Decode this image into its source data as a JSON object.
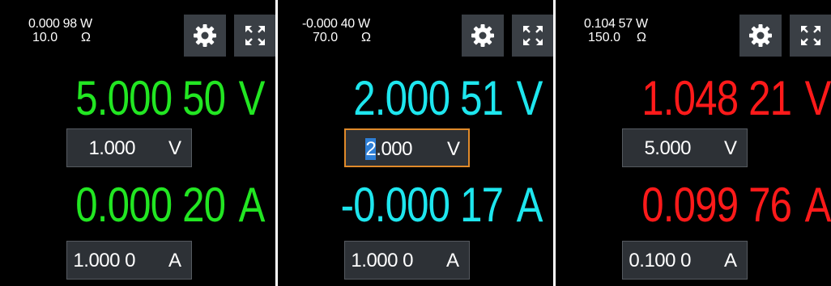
{
  "panels": [
    {
      "power": "0.000 98 W",
      "resistance": "10.0",
      "resistance_unit": "Ω",
      "voltage_measured": "5.000 50",
      "voltage_unit": "V",
      "voltage_setpoint": "1.000",
      "voltage_setpoint_unit": "V",
      "current_measured": "0.000 20",
      "current_unit": "A",
      "current_setpoint": "1.000 0",
      "current_setpoint_unit": "A",
      "color": "#22e622"
    },
    {
      "power": "-0.000 40 W",
      "resistance": "70.0",
      "resistance_unit": "Ω",
      "voltage_measured": "2.000 51",
      "voltage_unit": "V",
      "voltage_setpoint_cursor": "2",
      "voltage_setpoint_rest": ".000",
      "voltage_setpoint_unit": "V",
      "current_measured": "-0.000 17",
      "current_unit": "A",
      "current_setpoint": "1.000 0",
      "current_setpoint_unit": "A",
      "color": "#1ee6ee",
      "active_field_color": "#e08a2a"
    },
    {
      "power": "0.104 57 W",
      "resistance": "150.0",
      "resistance_unit": "Ω",
      "voltage_measured": "1.048 21",
      "voltage_unit": "V",
      "voltage_setpoint": "5.000",
      "voltage_setpoint_unit": "V",
      "current_measured": "0.099 76",
      "current_unit": "A",
      "current_setpoint": "0.100 0",
      "current_setpoint_unit": "A",
      "color": "#ff1a1a"
    }
  ],
  "icons": {
    "settings": "gear-icon",
    "expand": "expand-icon"
  }
}
